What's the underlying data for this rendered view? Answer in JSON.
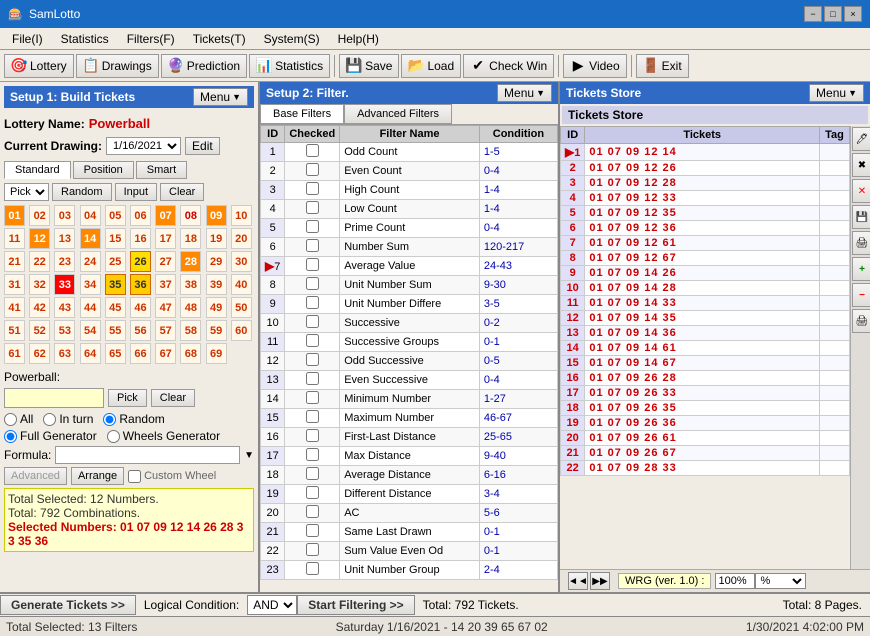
{
  "app": {
    "title": "SamLotto",
    "icon": "🎰"
  },
  "titlebar": {
    "title": "SamLotto",
    "minimize": "−",
    "maximize": "□",
    "close": "×"
  },
  "menubar": {
    "items": [
      {
        "label": "File(I)",
        "key": "File"
      },
      {
        "label": "Statistics",
        "key": "Statistics"
      },
      {
        "label": "Filters(F)",
        "key": "Filters"
      },
      {
        "label": "Tickets(T)",
        "key": "Tickets"
      },
      {
        "label": "System(S)",
        "key": "System"
      },
      {
        "label": "Help(H)",
        "key": "Help"
      }
    ]
  },
  "toolbar": {
    "buttons": [
      {
        "label": "Lottery",
        "icon": "🎯"
      },
      {
        "label": "Drawings",
        "icon": "📋"
      },
      {
        "label": "Prediction",
        "icon": "🔮"
      },
      {
        "label": "Statistics",
        "icon": "📊"
      },
      {
        "label": "Save",
        "icon": "💾"
      },
      {
        "label": "Load",
        "icon": "📂"
      },
      {
        "label": "Check Win",
        "icon": "✔"
      },
      {
        "label": "Video",
        "icon": "▶"
      },
      {
        "label": "Exit",
        "icon": "🚪"
      }
    ]
  },
  "left_panel": {
    "header": "Setup 1: Build  Tickets",
    "menu_btn": "Menu ▼",
    "lottery_label": "Lottery  Name:",
    "lottery_name": "Powerball",
    "drawing_label": "Current Drawing:",
    "drawing_value": "1/16/2021",
    "edit_btn": "Edit",
    "tabs": [
      "Standard",
      "Position",
      "Smart"
    ],
    "active_tab": "Standard",
    "controls": {
      "pick_label": "Pick ▼",
      "random_btn": "Random",
      "input_btn": "Input",
      "clear_btn": "Clear"
    },
    "numbers": [
      "01",
      "02",
      "03",
      "04",
      "05",
      "06",
      "07",
      "08",
      "09",
      "10",
      "11",
      "12",
      "13",
      "14",
      "15",
      "16",
      "17",
      "18",
      "19",
      "20",
      "21",
      "22",
      "23",
      "24",
      "25",
      "26",
      "27",
      "28",
      "29",
      "30",
      "31",
      "32",
      "33",
      "34",
      "35",
      "36",
      "37",
      "38",
      "39",
      "40",
      "41",
      "42",
      "43",
      "44",
      "45",
      "46",
      "47",
      "48",
      "49",
      "50",
      "51",
      "52",
      "53",
      "54",
      "55",
      "56",
      "57",
      "58",
      "59",
      "60",
      "61",
      "62",
      "63",
      "64",
      "65",
      "66",
      "67",
      "68",
      "69"
    ],
    "selected_numbers": [
      "01",
      "07",
      "09",
      "12",
      "14",
      "26",
      "28",
      "33",
      "35",
      "36"
    ],
    "powerball_label": "Powerball:",
    "pb_pick_btn": "Pick",
    "pb_clear_btn": "Clear",
    "radio_all": "All",
    "radio_in_turn": "In turn",
    "radio_random": "Random",
    "radio_random_selected": true,
    "gen_full": "Full Generator",
    "gen_wheels": "Wheels Generator",
    "gen_full_selected": true,
    "formula_label": "Formula:",
    "formula_placeholder": "",
    "advanced_btn": "Advanced",
    "arrange_btn": "Arrange",
    "custom_wheel": "Custom Wheel",
    "summary": {
      "line1": "Total Selected: 12 Numbers.",
      "line2": "Total: 792 Combinations.",
      "line3": "Selected Numbers: 01 07 09 12 14 26 28 33 35 36"
    }
  },
  "mid_panel": {
    "header": "Setup 2: Filter.",
    "menu_btn": "Menu ▼",
    "tabs": [
      "Base Filters",
      "Advanced Filters"
    ],
    "active_tab": "Base Filters",
    "columns": [
      "ID",
      "Checked",
      "Filter Name",
      "Condition"
    ],
    "filters": [
      {
        "id": "1",
        "checked": false,
        "name": "Odd Count",
        "condition": "1-5"
      },
      {
        "id": "2",
        "checked": false,
        "name": "Even Count",
        "condition": "0-4"
      },
      {
        "id": "3",
        "checked": false,
        "name": "High Count",
        "condition": "1-4"
      },
      {
        "id": "4",
        "checked": false,
        "name": "Low Count",
        "condition": "1-4"
      },
      {
        "id": "5",
        "checked": false,
        "name": "Prime Count",
        "condition": "0-4"
      },
      {
        "id": "6",
        "checked": false,
        "name": "Number Sum",
        "condition": "120-217"
      },
      {
        "id": "7",
        "checked": false,
        "name": "Average Value",
        "condition": "24-43"
      },
      {
        "id": "8",
        "checked": false,
        "name": "Unit Number Sum",
        "condition": "9-30"
      },
      {
        "id": "9",
        "checked": false,
        "name": "Unit Number Differe",
        "condition": "3-5"
      },
      {
        "id": "10",
        "checked": false,
        "name": "Successive",
        "condition": "0-2"
      },
      {
        "id": "11",
        "checked": false,
        "name": "Successive Groups",
        "condition": "0-1"
      },
      {
        "id": "12",
        "checked": false,
        "name": "Odd Successive",
        "condition": "0-5"
      },
      {
        "id": "13",
        "checked": false,
        "name": "Even Successive",
        "condition": "0-4"
      },
      {
        "id": "14",
        "checked": false,
        "name": "Minimum Number",
        "condition": "1-27"
      },
      {
        "id": "15",
        "checked": false,
        "name": "Maximum Number",
        "condition": "46-67"
      },
      {
        "id": "16",
        "checked": false,
        "name": "First-Last Distance",
        "condition": "25-65"
      },
      {
        "id": "17",
        "checked": false,
        "name": "Max Distance",
        "condition": "9-40"
      },
      {
        "id": "18",
        "checked": false,
        "name": "Average Distance",
        "condition": "6-16"
      },
      {
        "id": "19",
        "checked": false,
        "name": "Different Distance",
        "condition": "3-4"
      },
      {
        "id": "20",
        "checked": false,
        "name": "AC",
        "condition": "5-6"
      },
      {
        "id": "21",
        "checked": false,
        "name": "Same Last Drawn",
        "condition": "0-1"
      },
      {
        "id": "22",
        "checked": false,
        "name": "Sum Value Even Od",
        "condition": "0-1"
      },
      {
        "id": "23",
        "checked": false,
        "name": "Unit Number Group",
        "condition": "2-4"
      }
    ]
  },
  "right_panel": {
    "header": "Tickets Store",
    "menu_btn": "Menu ▼",
    "inner_label": "Tickets Store",
    "columns": [
      "ID",
      "Tickets",
      "Tag"
    ],
    "tickets": [
      {
        "id": "1",
        "nums": "01 07 09 12 14"
      },
      {
        "id": "2",
        "nums": "01 07 09 12 26"
      },
      {
        "id": "3",
        "nums": "01 07 09 12 28"
      },
      {
        "id": "4",
        "nums": "01 07 09 12 33"
      },
      {
        "id": "5",
        "nums": "01 07 09 12 35"
      },
      {
        "id": "6",
        "nums": "01 07 09 12 36"
      },
      {
        "id": "7",
        "nums": "01 07 09 12 61"
      },
      {
        "id": "8",
        "nums": "01 07 09 12 67"
      },
      {
        "id": "9",
        "nums": "01 07 09 14 26"
      },
      {
        "id": "10",
        "nums": "01 07 09 14 28"
      },
      {
        "id": "11",
        "nums": "01 07 09 14 33"
      },
      {
        "id": "12",
        "nums": "01 07 09 14 35"
      },
      {
        "id": "13",
        "nums": "01 07 09 14 36"
      },
      {
        "id": "14",
        "nums": "01 07 09 14 61"
      },
      {
        "id": "15",
        "nums": "01 07 09 14 67"
      },
      {
        "id": "16",
        "nums": "01 07 09 26 28"
      },
      {
        "id": "17",
        "nums": "01 07 09 26 33"
      },
      {
        "id": "18",
        "nums": "01 07 09 26 35"
      },
      {
        "id": "19",
        "nums": "01 07 09 26 36"
      },
      {
        "id": "20",
        "nums": "01 07 09 26 61"
      },
      {
        "id": "21",
        "nums": "01 07 09 26 67"
      },
      {
        "id": "22",
        "nums": "01 07 09 28 33"
      }
    ],
    "tools": [
      "🖊",
      "✖",
      "✕",
      "💾",
      "🖨",
      "➕",
      "➖",
      "🖨"
    ],
    "pager": {
      "prev_btn": "◄◄",
      "next_btn": "►►",
      "version": "WRG (ver. 1.0) :",
      "zoom": "100%"
    }
  },
  "bottom_bar": {
    "generate_btn": "Generate Tickets >>",
    "logical_label": "Logical Condition:",
    "logical_value": "AND",
    "start_filter_btn": "Start Filtering >>",
    "total_label": "Total: 792 Tickets.",
    "total_pages": "Total: 8 Pages."
  },
  "status_bar": {
    "left": "Total Selected: 13 Filters",
    "mid": "Saturday 1/16/2021 - 14 20 39 65 67 02",
    "right": "1/30/2021 4:02:00 PM"
  }
}
